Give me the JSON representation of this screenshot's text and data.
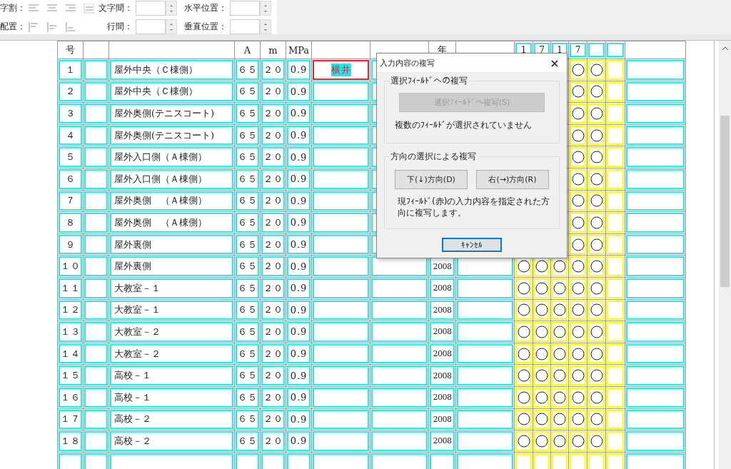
{
  "toolbar": {
    "rows": [
      {
        "kind": "horizontal",
        "label": "字割：",
        "spin_1": "文字間：",
        "spin_2": "水平位置："
      },
      {
        "kind": "vertical",
        "label": "配置：",
        "spin_1": "行間：",
        "spin_2": "垂直位置："
      }
    ]
  },
  "table": {
    "header": {
      "no": "号",
      "a": "A",
      "m": "m",
      "mpa": "MPa",
      "year": "年",
      "digits": [
        "1",
        "7",
        "1",
        "7"
      ]
    },
    "rows": [
      {
        "no": "１",
        "name": "屋外中央（Ｃ棟側）",
        "a": "６５",
        "m": "２０",
        "mpa": "0.9",
        "col_7": "横井",
        "current": true,
        "mark_4": true,
        "mark_5": true,
        "mark_6": false
      },
      {
        "no": "２",
        "name": "屋外中央（Ｃ棟側）",
        "a": "６５",
        "m": "２０",
        "mpa": "0.9",
        "current": false,
        "mark_4": true,
        "mark_5": true,
        "mark_6": false
      },
      {
        "no": "３",
        "name": "屋外奥側(テニスコート)",
        "a": "６５",
        "m": "２０",
        "mpa": "0.9",
        "current": false,
        "mark_4": true,
        "mark_5": true,
        "mark_6": false
      },
      {
        "no": "４",
        "name": "屋外奥側(テニスコート)",
        "a": "６５",
        "m": "２０",
        "mpa": "0.9",
        "current": false,
        "mark_4": true,
        "mark_5": true,
        "mark_6": false
      },
      {
        "no": "５",
        "name": "屋外入口側（Ａ棟側）",
        "a": "６５",
        "m": "２０",
        "mpa": "0.9",
        "current": false,
        "mark_4": true,
        "mark_5": true,
        "mark_6": false
      },
      {
        "no": "６",
        "name": "屋外入口側（Ａ棟側）",
        "a": "６５",
        "m": "２０",
        "mpa": "0.9",
        "current": false,
        "mark_4": true,
        "mark_5": true,
        "mark_6": false
      },
      {
        "no": "７",
        "name": "屋外奥側　（Ａ棟側）",
        "a": "６５",
        "m": "２０",
        "mpa": "0.9",
        "current": false,
        "mark_4": true,
        "mark_5": true,
        "mark_6": false
      },
      {
        "no": "８",
        "name": "屋外奥側　（Ａ棟側）",
        "a": "６５",
        "m": "２０",
        "mpa": "0.9",
        "current": false,
        "mark_4": true,
        "mark_5": true,
        "mark_6": false
      },
      {
        "no": "９",
        "name": "屋外裏側",
        "a": "６５",
        "m": "２０",
        "mpa": "0.9",
        "current": false,
        "mark_4": true,
        "mark_5": true,
        "mark_6": false
      },
      {
        "no": "１０",
        "name": "屋外裏側",
        "a": "６５",
        "m": "２０",
        "mpa": "0.9",
        "year": "2008",
        "current": false,
        "mark_1": true,
        "mark_2": true,
        "mark_3": true,
        "mark_4": true,
        "mark_5": true,
        "mark_6": false
      },
      {
        "no": "１１",
        "name": "大教室－１",
        "a": "６５",
        "m": "２０",
        "mpa": "0.9",
        "year": "2008",
        "current": false,
        "mark_1": true,
        "mark_2": true,
        "mark_3": true,
        "mark_4": true,
        "mark_5": true,
        "mark_6": false
      },
      {
        "no": "１２",
        "name": "大教室－１",
        "a": "６５",
        "m": "２０",
        "mpa": "0.9",
        "year": "2008",
        "current": false,
        "mark_1": true,
        "mark_2": true,
        "mark_3": true,
        "mark_4": true,
        "mark_5": true,
        "mark_6": false
      },
      {
        "no": "１３",
        "name": "大教室－２",
        "a": "６５",
        "m": "２０",
        "mpa": "0.9",
        "year": "2008",
        "current": false,
        "mark_1": true,
        "mark_2": true,
        "mark_3": true,
        "mark_4": true,
        "mark_5": true,
        "mark_6": false
      },
      {
        "no": "１４",
        "name": "大教室－２",
        "a": "６５",
        "m": "２０",
        "mpa": "0.9",
        "year": "2008",
        "current": false,
        "mark_1": true,
        "mark_2": true,
        "mark_3": true,
        "mark_4": true,
        "mark_5": true,
        "mark_6": false
      },
      {
        "no": "１５",
        "name": "高校－１",
        "a": "６５",
        "m": "２０",
        "mpa": "0.9",
        "year": "2008",
        "current": false,
        "mark_1": true,
        "mark_2": true,
        "mark_3": true,
        "mark_4": true,
        "mark_5": true,
        "mark_6": false
      },
      {
        "no": "１６",
        "name": "高校－１",
        "a": "６５",
        "m": "２０",
        "mpa": "0.9",
        "year": "2008",
        "current": false,
        "mark_1": true,
        "mark_2": true,
        "mark_3": true,
        "mark_4": true,
        "mark_5": true,
        "mark_6": false
      },
      {
        "no": "１７",
        "name": "高校－２",
        "a": "６５",
        "m": "２０",
        "mpa": "0.9",
        "year": "2008",
        "current": false,
        "mark_1": true,
        "mark_2": true,
        "mark_3": true,
        "mark_4": true,
        "mark_5": true,
        "mark_6": false
      },
      {
        "no": "１８",
        "name": "高校－２",
        "a": "６５",
        "m": "２０",
        "mpa": "0.9",
        "year": "2008",
        "current": false,
        "mark_1": true,
        "mark_2": true,
        "mark_3": true,
        "mark_4": true,
        "mark_5": true,
        "mark_6": false
      },
      {
        "current": false,
        "mark_1": false,
        "mark_2": false,
        "mark_3": false,
        "mark_4": false,
        "mark_5": false,
        "mark_6": false
      }
    ]
  },
  "dialog": {
    "title": "入力内容の複写",
    "close": "×",
    "group_1": {
      "title": "選択ﾌｨｰﾙﾄﾞへの複写",
      "button": {
        "label": "選択ﾌｨｰﾙﾄﾞへ複写(S)",
        "disabled": true
      },
      "note": "複数のﾌｨｰﾙﾄﾞが選択されていません"
    },
    "group_2": {
      "title": "方向の選択による複写",
      "buttons": [
        "下(↓)方向(D)",
        "右(→)方向(R)"
      ],
      "note": "現ﾌｨｰﾙﾄﾞ(赤)の入力内容を指定された方向に複写します。"
    },
    "cancel": "ｷｬﾝｾﾙ"
  }
}
